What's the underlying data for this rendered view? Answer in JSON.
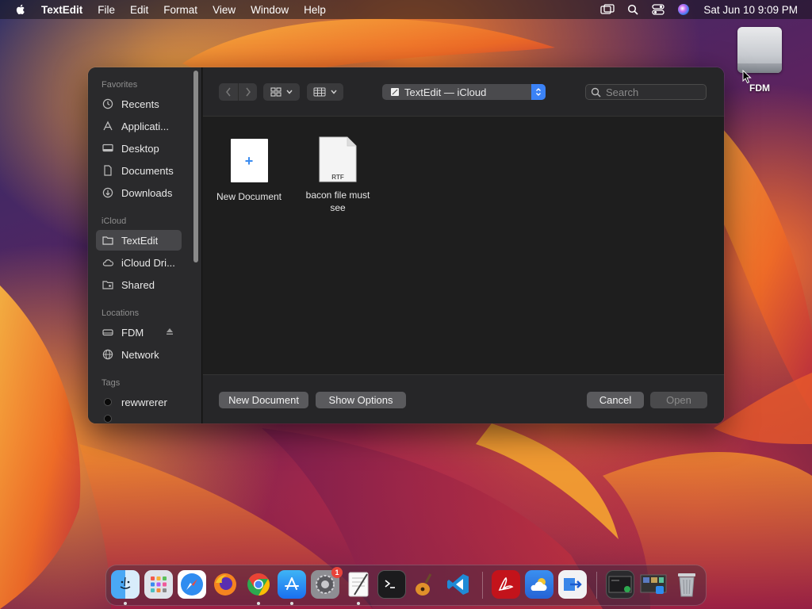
{
  "menubar": {
    "app_name": "TextEdit",
    "menus": [
      "File",
      "Edit",
      "Format",
      "View",
      "Window",
      "Help"
    ],
    "clock": "Sat Jun 10  9:09 PM"
  },
  "desktop": {
    "disk_label": "FDM"
  },
  "dialog": {
    "sidebar": {
      "favorites_header": "Favorites",
      "favorites": [
        "Recents",
        "Applicati...",
        "Desktop",
        "Documents",
        "Downloads"
      ],
      "icloud_header": "iCloud",
      "icloud": [
        "TextEdit",
        "iCloud Dri...",
        "Shared"
      ],
      "selected": "TextEdit",
      "locations_header": "Locations",
      "locations": [
        "FDM",
        "Network"
      ],
      "tags_header": "Tags",
      "tags": [
        "rewwrerer"
      ]
    },
    "toolbar": {
      "location": "TextEdit — iCloud",
      "search_placeholder": "Search"
    },
    "files": [
      {
        "name": "New Document",
        "kind": "new"
      },
      {
        "name": "bacon file must see",
        "kind": "rtf",
        "badge": "RTF"
      }
    ],
    "buttons": {
      "new_document": "New Document",
      "show_options": "Show Options",
      "cancel": "Cancel",
      "open": "Open"
    }
  },
  "dock": {
    "apps": [
      "finder-icon",
      "launchpad-icon",
      "safari-icon",
      "firefox-icon",
      "chrome-icon",
      "app-store-icon",
      "system-settings-icon",
      "textedit-icon",
      "terminal-icon",
      "garageband-icon",
      "vscode-icon",
      "acrobat-icon",
      "weather-icon",
      "migration-icon",
      "recent-window-icon",
      "recent-window2-icon",
      "trash-icon"
    ],
    "settings_badge": "1"
  }
}
